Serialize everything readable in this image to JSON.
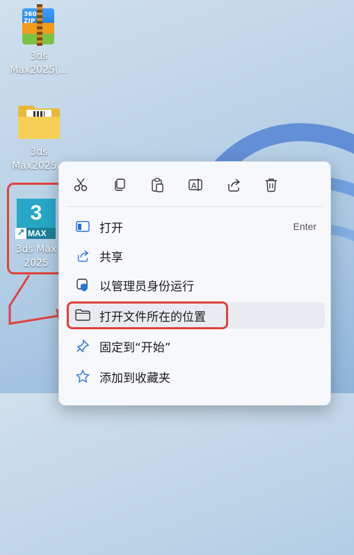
{
  "desktop": {
    "icons": [
      {
        "label_line1": "3ds",
        "label_line2": "Max2025(...",
        "type": "zip",
        "zip_text": "360\nZIP"
      },
      {
        "label_line1": "3ds",
        "label_line2": "Max2025...",
        "type": "folder"
      },
      {
        "label_line1": "3ds Max",
        "label_line2": "2025",
        "type": "app",
        "app_number": "3",
        "app_sub": "MAX"
      }
    ]
  },
  "context_menu": {
    "toolbar": [
      "cut-icon",
      "copy-icon",
      "paste-icon",
      "rename-icon",
      "share-icon",
      "delete-icon"
    ],
    "items": [
      {
        "label": "打开",
        "shortcut": "Enter",
        "icon": "open-app-icon"
      },
      {
        "label": "共享",
        "shortcut": "",
        "icon": "share-icon"
      },
      {
        "label": "以管理员身份运行",
        "shortcut": "",
        "icon": "admin-shield-icon"
      },
      {
        "label": "打开文件所在的位置",
        "shortcut": "",
        "icon": "folder-icon"
      },
      {
        "label": "固定到“开始”",
        "shortcut": "",
        "icon": "pin-icon"
      },
      {
        "label": "添加到收藏夹",
        "shortcut": "",
        "icon": "star-icon"
      }
    ]
  },
  "colors": {
    "highlight": "#e0413c",
    "accent": "#2a74d6"
  }
}
